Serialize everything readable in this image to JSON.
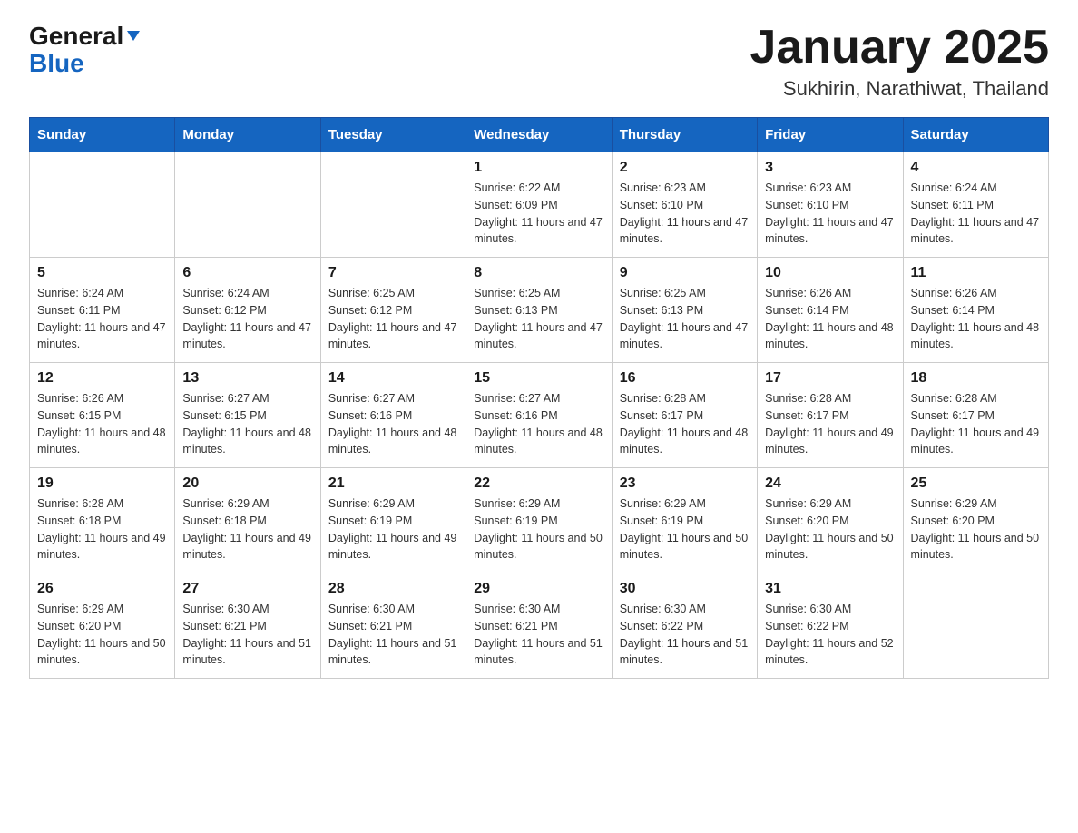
{
  "logo": {
    "general": "General",
    "blue": "Blue"
  },
  "header": {
    "month": "January 2025",
    "location": "Sukhirin, Narathiwat, Thailand"
  },
  "weekdays": [
    "Sunday",
    "Monday",
    "Tuesday",
    "Wednesday",
    "Thursday",
    "Friday",
    "Saturday"
  ],
  "weeks": [
    [
      {
        "day": "",
        "info": ""
      },
      {
        "day": "",
        "info": ""
      },
      {
        "day": "",
        "info": ""
      },
      {
        "day": "1",
        "info": "Sunrise: 6:22 AM\nSunset: 6:09 PM\nDaylight: 11 hours and 47 minutes."
      },
      {
        "day": "2",
        "info": "Sunrise: 6:23 AM\nSunset: 6:10 PM\nDaylight: 11 hours and 47 minutes."
      },
      {
        "day": "3",
        "info": "Sunrise: 6:23 AM\nSunset: 6:10 PM\nDaylight: 11 hours and 47 minutes."
      },
      {
        "day": "4",
        "info": "Sunrise: 6:24 AM\nSunset: 6:11 PM\nDaylight: 11 hours and 47 minutes."
      }
    ],
    [
      {
        "day": "5",
        "info": "Sunrise: 6:24 AM\nSunset: 6:11 PM\nDaylight: 11 hours and 47 minutes."
      },
      {
        "day": "6",
        "info": "Sunrise: 6:24 AM\nSunset: 6:12 PM\nDaylight: 11 hours and 47 minutes."
      },
      {
        "day": "7",
        "info": "Sunrise: 6:25 AM\nSunset: 6:12 PM\nDaylight: 11 hours and 47 minutes."
      },
      {
        "day": "8",
        "info": "Sunrise: 6:25 AM\nSunset: 6:13 PM\nDaylight: 11 hours and 47 minutes."
      },
      {
        "day": "9",
        "info": "Sunrise: 6:25 AM\nSunset: 6:13 PM\nDaylight: 11 hours and 47 minutes."
      },
      {
        "day": "10",
        "info": "Sunrise: 6:26 AM\nSunset: 6:14 PM\nDaylight: 11 hours and 48 minutes."
      },
      {
        "day": "11",
        "info": "Sunrise: 6:26 AM\nSunset: 6:14 PM\nDaylight: 11 hours and 48 minutes."
      }
    ],
    [
      {
        "day": "12",
        "info": "Sunrise: 6:26 AM\nSunset: 6:15 PM\nDaylight: 11 hours and 48 minutes."
      },
      {
        "day": "13",
        "info": "Sunrise: 6:27 AM\nSunset: 6:15 PM\nDaylight: 11 hours and 48 minutes."
      },
      {
        "day": "14",
        "info": "Sunrise: 6:27 AM\nSunset: 6:16 PM\nDaylight: 11 hours and 48 minutes."
      },
      {
        "day": "15",
        "info": "Sunrise: 6:27 AM\nSunset: 6:16 PM\nDaylight: 11 hours and 48 minutes."
      },
      {
        "day": "16",
        "info": "Sunrise: 6:28 AM\nSunset: 6:17 PM\nDaylight: 11 hours and 48 minutes."
      },
      {
        "day": "17",
        "info": "Sunrise: 6:28 AM\nSunset: 6:17 PM\nDaylight: 11 hours and 49 minutes."
      },
      {
        "day": "18",
        "info": "Sunrise: 6:28 AM\nSunset: 6:17 PM\nDaylight: 11 hours and 49 minutes."
      }
    ],
    [
      {
        "day": "19",
        "info": "Sunrise: 6:28 AM\nSunset: 6:18 PM\nDaylight: 11 hours and 49 minutes."
      },
      {
        "day": "20",
        "info": "Sunrise: 6:29 AM\nSunset: 6:18 PM\nDaylight: 11 hours and 49 minutes."
      },
      {
        "day": "21",
        "info": "Sunrise: 6:29 AM\nSunset: 6:19 PM\nDaylight: 11 hours and 49 minutes."
      },
      {
        "day": "22",
        "info": "Sunrise: 6:29 AM\nSunset: 6:19 PM\nDaylight: 11 hours and 50 minutes."
      },
      {
        "day": "23",
        "info": "Sunrise: 6:29 AM\nSunset: 6:19 PM\nDaylight: 11 hours and 50 minutes."
      },
      {
        "day": "24",
        "info": "Sunrise: 6:29 AM\nSunset: 6:20 PM\nDaylight: 11 hours and 50 minutes."
      },
      {
        "day": "25",
        "info": "Sunrise: 6:29 AM\nSunset: 6:20 PM\nDaylight: 11 hours and 50 minutes."
      }
    ],
    [
      {
        "day": "26",
        "info": "Sunrise: 6:29 AM\nSunset: 6:20 PM\nDaylight: 11 hours and 50 minutes."
      },
      {
        "day": "27",
        "info": "Sunrise: 6:30 AM\nSunset: 6:21 PM\nDaylight: 11 hours and 51 minutes."
      },
      {
        "day": "28",
        "info": "Sunrise: 6:30 AM\nSunset: 6:21 PM\nDaylight: 11 hours and 51 minutes."
      },
      {
        "day": "29",
        "info": "Sunrise: 6:30 AM\nSunset: 6:21 PM\nDaylight: 11 hours and 51 minutes."
      },
      {
        "day": "30",
        "info": "Sunrise: 6:30 AM\nSunset: 6:22 PM\nDaylight: 11 hours and 51 minutes."
      },
      {
        "day": "31",
        "info": "Sunrise: 6:30 AM\nSunset: 6:22 PM\nDaylight: 11 hours and 52 minutes."
      },
      {
        "day": "",
        "info": ""
      }
    ]
  ]
}
